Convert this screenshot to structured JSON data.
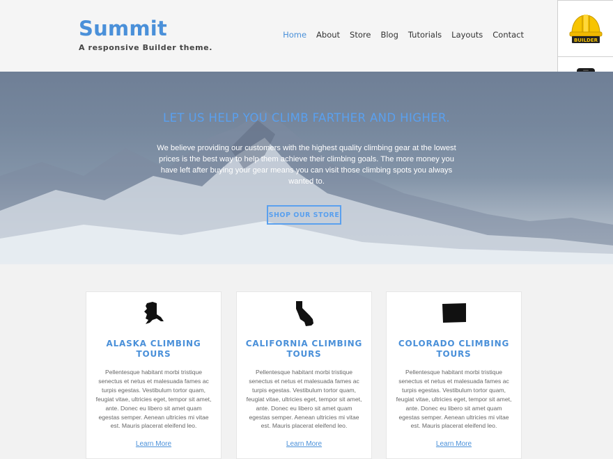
{
  "site": {
    "title": "Summit",
    "tagline": "A responsive Builder theme."
  },
  "nav": {
    "items": [
      {
        "label": "Home",
        "active": true
      },
      {
        "label": "About"
      },
      {
        "label": "Store"
      },
      {
        "label": "Blog"
      },
      {
        "label": "Tutorials"
      },
      {
        "label": "Layouts"
      },
      {
        "label": "Contact"
      }
    ]
  },
  "side_widget": {
    "builder_icon": "builder-helmet-icon",
    "builder_label": "BUILDER",
    "mobile_icon": "mobile-arrow-icon"
  },
  "hero": {
    "title": "LET US HELP YOU CLIMB FARTHER AND HIGHER.",
    "text": "We believe providing our customers with the highest quality climbing gear at the lowest prices is the best way to help them achieve their climbing goals. The more money you have left after buying your gear means you can visit those climbing spots you always wanted to.",
    "button": "SHOP OUR STORE"
  },
  "cards": [
    {
      "icon": "alaska-state-icon",
      "title": "ALASKA CLIMBING TOURS",
      "text": "Pellentesque habitant morbi tristique senectus et netus et malesuada fames ac turpis egestas. Vestibulum tortor quam, feugiat vitae, ultricies eget, tempor sit amet, ante. Donec eu libero sit amet quam egestas semper. Aenean ultricies mi vitae est. Mauris placerat eleifend leo.",
      "link": "Learn More"
    },
    {
      "icon": "california-state-icon",
      "title": "CALIFORNIA CLIMBING TOURS",
      "text": "Pellentesque habitant morbi tristique senectus et netus et malesuada fames ac turpis egestas. Vestibulum tortor quam, feugiat vitae, ultricies eget, tempor sit amet, ante. Donec eu libero sit amet quam egestas semper. Aenean ultricies mi vitae est. Mauris placerat eleifend leo.",
      "link": "Learn More"
    },
    {
      "icon": "colorado-state-icon",
      "title": "COLORADO CLIMBING TOURS",
      "text": "Pellentesque habitant morbi tristique senectus et netus et malesuada fames ac turpis egestas. Vestibulum tortor quam, feugiat vitae, ultricies eget, tempor sit amet, ante. Donec eu libero sit amet quam egestas semper. Aenean ultricies mi vitae est. Mauris placerat eleifend leo.",
      "link": "Learn More"
    }
  ],
  "colors": {
    "accent": "#4a90d9",
    "hero_accent": "#5aa0ee",
    "page_bg": "#f2f2f2"
  }
}
